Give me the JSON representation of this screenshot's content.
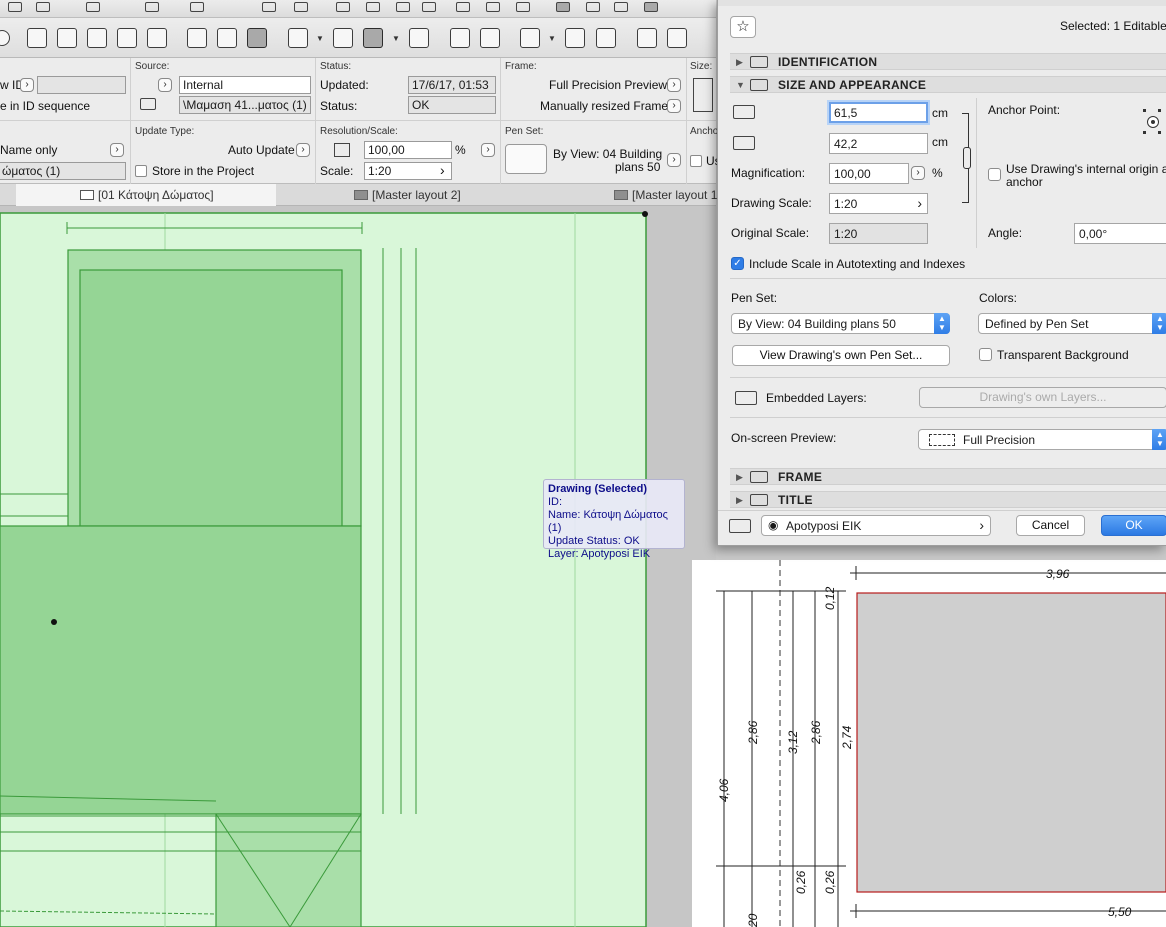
{
  "dialog": {
    "selected_text": "Selected: 1 Editable",
    "sections": {
      "identification": "IDENTIFICATION",
      "size": "SIZE AND APPEARANCE",
      "frame": "FRAME",
      "title": "TITLE"
    },
    "width_value": "61,5",
    "height_value": "42,2",
    "unit_cm": "cm",
    "magnification_label": "Magnification:",
    "magnification_value": "100,00",
    "percent": "%",
    "drawing_scale_label": "Drawing Scale:",
    "drawing_scale_value": "1:20",
    "original_scale_label": "Original Scale:",
    "original_scale_value": "1:20",
    "anchor_label": "Anchor Point:",
    "use_origin_label": "Use Drawing's internal origin as",
    "use_origin_label2": "anchor",
    "angle_label": "Angle:",
    "angle_value": "0,00°",
    "include_scale_label": "Include Scale in Autotexting and Indexes",
    "pen_set_label": "Pen Set:",
    "pen_set_value": "By View: 04 Building plans 50",
    "colors_label": "Colors:",
    "colors_value": "Defined by Pen Set",
    "view_pen_set_btn": "View Drawing's own Pen Set...",
    "transparent_label": "Transparent Background",
    "embedded_layers_label": "Embedded Layers:",
    "own_layers_btn": "Drawing's own Layers...",
    "onscreen_label": "On-screen Preview:",
    "onscreen_value": "Full Precision",
    "layer_value": "Apotyposi EIK",
    "cancel": "Cancel",
    "ok": "OK"
  },
  "infobox": {
    "id_label": "w ID",
    "id_seq": "e in ID sequence",
    "source_label": "Source:",
    "source_value": "Internal",
    "source_path": "\\Μαμαση 41...ματος (1)",
    "status_header": "Status:",
    "updated_label": "Updated:",
    "updated_value": "17/6/17, 01:53",
    "status_label": "Status:",
    "status_value": "OK",
    "frame_label": "Frame:",
    "frame_value1": "Full Precision Preview",
    "frame_value2": "Manually resized Frame",
    "size_label": "Size:",
    "name_only": "Name only",
    "name_value": "ώματος (1)",
    "update_type_label": "Update Type:",
    "update_type_value": "Auto Update",
    "store_label": "Store in the Project",
    "resscale_label": "Resolution/Scale:",
    "res_value": "100,00",
    "percent": "%",
    "scale_label": "Scale:",
    "scale_value": "1:20",
    "penset_label": "Pen Set:",
    "penset_value1": "By View: 04 Building",
    "penset_value2": "plans 50",
    "anchor_label": "Ancho",
    "use_label": "Us"
  },
  "tabs": [
    "[01 Κάτοψη Δώματος]",
    "[Master layout 2]",
    "[Master layout 1"
  ],
  "tooltip": {
    "title": "Drawing (Selected)",
    "id": "ID:",
    "name": "Name: Κάτοψη Δώματος (1)",
    "status": "Update Status: OK",
    "layer": "Layer: Apotyposi EIK"
  },
  "dimensions": {
    "top": "3,96",
    "bottom": "5,50",
    "v1": "4,06",
    "v2": "2,86",
    "v3": "3,12",
    "v4": "2,86",
    "v5": "2,74",
    "v6": "0,12",
    "v7": "0,26",
    "v8": "0,26",
    "v9": "20"
  },
  "colors": {
    "selection_fill": "#d9f7d9",
    "selection_stroke": "#3a9a3a",
    "dark_fill": "#95d595",
    "accent_blue": "#2f7de6"
  }
}
